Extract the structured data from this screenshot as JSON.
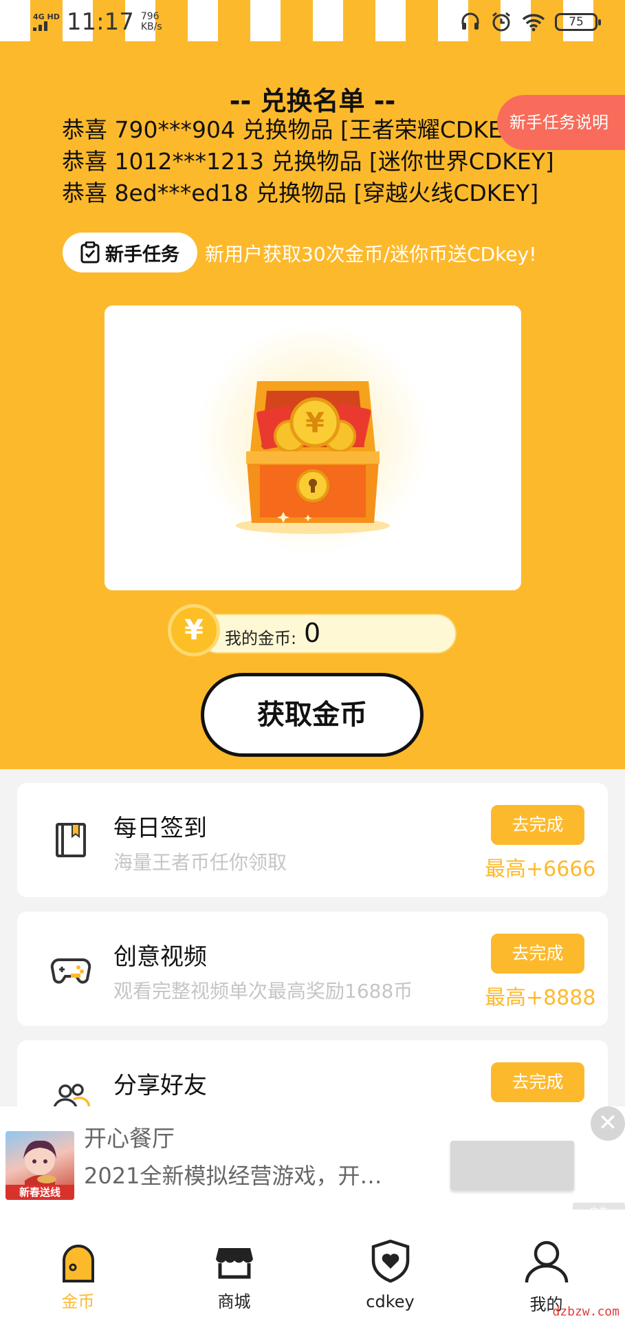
{
  "status_bar": {
    "network": "4G HD",
    "time": "11:17",
    "speed_value": "796",
    "speed_unit": "KB/s",
    "battery": "75"
  },
  "exchange": {
    "title": "-- 兑换名单 --",
    "entries": [
      "恭喜 790***904 兑换物品 [王者荣耀CDKEY]",
      "恭喜 1012***1213 兑换物品 [迷你世界CDKEY]",
      "恭喜 8ed***ed18 兑换物品 [穿越火线CDKEY]"
    ]
  },
  "tip_tag": "新手任务说明",
  "novice": {
    "label": "新手任务",
    "text": "新用户获取30次金币/迷你币送CDkey!"
  },
  "coins": {
    "symbol": "¥",
    "label": "我的金币:",
    "value": "0"
  },
  "get_coins_button": "获取金币",
  "tasks": [
    {
      "name": "每日签到",
      "desc": "海量王者币任你领取",
      "button": "去完成",
      "reward": "最高+6666",
      "icon": "book-icon"
    },
    {
      "name": "创意视频",
      "desc": "观看完整视频单次最高奖励1688币",
      "button": "去完成",
      "reward": "最高+8888",
      "icon": "gamepad-icon"
    },
    {
      "name": "分享好友",
      "desc": "",
      "button": "去完成",
      "reward": "",
      "icon": "friends-icon"
    }
  ],
  "ad": {
    "title": "开心餐厅",
    "desc": "2021全新模拟经营游戏，开…",
    "badge": "新春送线",
    "close": "✕",
    "mark": "广告"
  },
  "nav": [
    {
      "label": "金币",
      "icon": "coin-tab-icon"
    },
    {
      "label": "商城",
      "icon": "shop-icon"
    },
    {
      "label": "cdkey",
      "icon": "shield-heart-icon"
    },
    {
      "label": "我的",
      "icon": "user-icon"
    }
  ],
  "watermark": "dzbzw.com",
  "colors": {
    "accent": "#fdb92c",
    "tip_tag": "#f96b5a",
    "ad_badge": "#d8322d"
  }
}
